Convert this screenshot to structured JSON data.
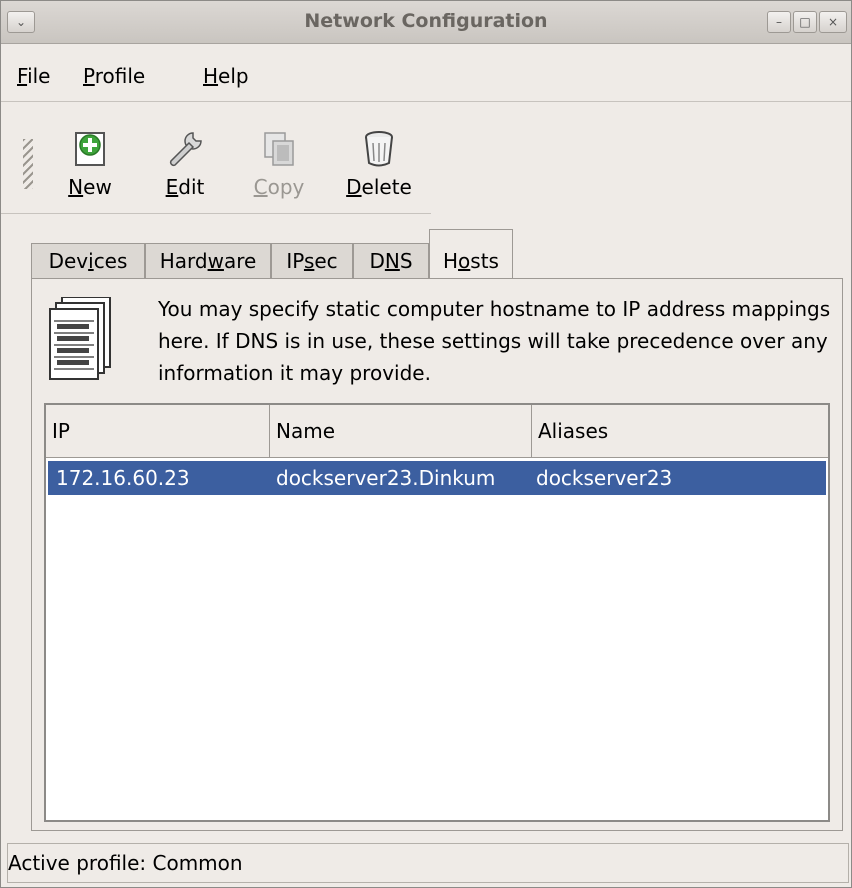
{
  "window": {
    "title": "Network Configuration",
    "menu_btn": "⌄",
    "min_btn": "–",
    "max_btn": "□",
    "close_btn": "×"
  },
  "menubar": {
    "items": [
      {
        "label_u": "F",
        "label_rest": "ile"
      },
      {
        "label_u": "P",
        "label_rest": "rofile"
      },
      {
        "label_u": "H",
        "label_rest": "elp"
      }
    ]
  },
  "toolbar": {
    "new": {
      "u": "N",
      "rest": "ew",
      "icon": "new-icon"
    },
    "edit": {
      "u": "E",
      "rest": "dit",
      "icon": "wrench-icon"
    },
    "copy": {
      "u": "C",
      "rest": "opy",
      "icon": "copy-icon",
      "disabled": true
    },
    "delete": {
      "u": "D",
      "rest": "elete",
      "icon": "trash-icon"
    }
  },
  "tabs": [
    {
      "pre": "Dev",
      "u": "i",
      "post": "ces"
    },
    {
      "pre": "Hard",
      "u": "w",
      "post": "are"
    },
    {
      "pre": "IP",
      "u": "s",
      "post": "ec"
    },
    {
      "pre": "D",
      "u": "N",
      "post": "S"
    },
    {
      "pre": "H",
      "u": "o",
      "post": "sts",
      "active": true
    }
  ],
  "hosts_panel": {
    "description": "You may specify static computer hostname to IP address mappings here.  If DNS is in use, these settings will take precedence over any information it may provide.",
    "icon": "hosts-list-icon",
    "columns": [
      "IP",
      "Name",
      "Aliases"
    ],
    "rows": [
      {
        "ip": "172.16.60.23",
        "name": "dockserver23.Dinkum",
        "aliases": "dockserver23",
        "selected": true
      }
    ]
  },
  "statusbar": {
    "text": "Active profile: Common"
  },
  "colors": {
    "selection": "#3c5fa0",
    "background": "#efebe7"
  }
}
